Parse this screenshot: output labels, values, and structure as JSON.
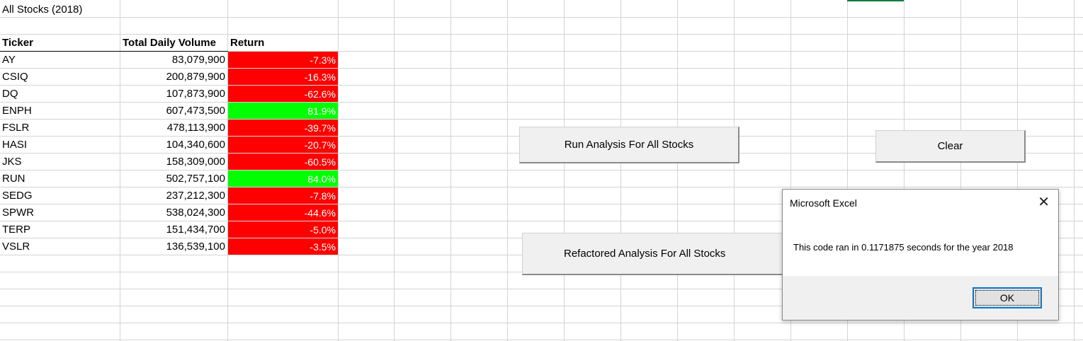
{
  "sheet": {
    "title": "All Stocks (2018)",
    "headers": {
      "ticker": "Ticker",
      "volume": "Total Daily Volume",
      "return": "Return"
    },
    "rows": [
      {
        "ticker": "AY",
        "volume": "83,079,900",
        "return": "-7.3%",
        "positive": false
      },
      {
        "ticker": "CSIQ",
        "volume": "200,879,900",
        "return": "-16.3%",
        "positive": false
      },
      {
        "ticker": "DQ",
        "volume": "107,873,900",
        "return": "-62.6%",
        "positive": false
      },
      {
        "ticker": "ENPH",
        "volume": "607,473,500",
        "return": "81.9%",
        "positive": true
      },
      {
        "ticker": "FSLR",
        "volume": "478,113,900",
        "return": "-39.7%",
        "positive": false
      },
      {
        "ticker": "HASI",
        "volume": "104,340,600",
        "return": "-20.7%",
        "positive": false
      },
      {
        "ticker": "JKS",
        "volume": "158,309,000",
        "return": "-60.5%",
        "positive": false
      },
      {
        "ticker": "RUN",
        "volume": "502,757,100",
        "return": "84.0%",
        "positive": true
      },
      {
        "ticker": "SEDG",
        "volume": "237,212,300",
        "return": "-7.8%",
        "positive": false
      },
      {
        "ticker": "SPWR",
        "volume": "538,024,300",
        "return": "-44.6%",
        "positive": false
      },
      {
        "ticker": "TERP",
        "volume": "151,434,700",
        "return": "-5.0%",
        "positive": false
      },
      {
        "ticker": "VSLR",
        "volume": "136,539,100",
        "return": "-3.5%",
        "positive": false
      }
    ]
  },
  "buttons": {
    "run_analysis": "Run Analysis For All Stocks",
    "clear": "Clear",
    "refactored_analysis": "Refactored Analysis For All Stocks"
  },
  "dialog": {
    "title": "Microsoft Excel",
    "message": "This code ran in 0.1171875 seconds for the year 2018",
    "ok_label": "OK"
  },
  "colors": {
    "positive": "#00ff00",
    "negative": "#ff0000",
    "accent": "#0078d7"
  },
  "icons": {
    "close": "close-icon"
  }
}
